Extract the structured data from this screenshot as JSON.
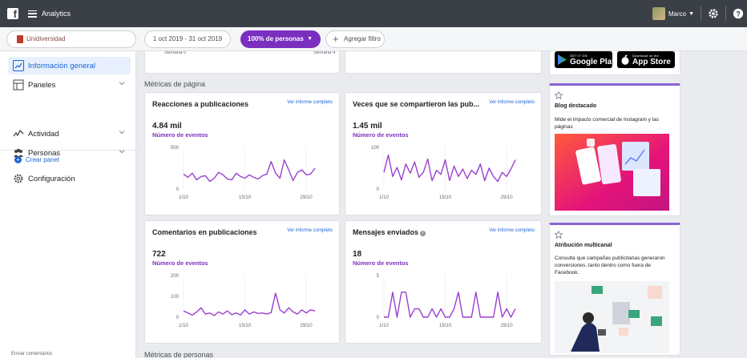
{
  "topbar": {
    "app_title": "Analytics",
    "user_name": "Marco"
  },
  "filters": {
    "source": "Unidiversidad",
    "date_range": "1 oct 2019 - 31 oct 2019",
    "audience": "100% de personas",
    "add_filter": "Agregar filtro"
  },
  "sidebar": {
    "items": [
      {
        "label": "Información general",
        "icon": "overview-chart-icon",
        "active": true
      },
      {
        "label": "Paneles",
        "icon": "dashboards-icon",
        "chevron": true
      },
      {
        "label": "Actividad",
        "icon": "activity-icon",
        "chevron": true
      },
      {
        "label": "Personas",
        "icon": "people-icon",
        "chevron": true
      },
      {
        "label": "Configuración",
        "icon": "settings-gear-icon"
      }
    ],
    "create_panel": "Crear panel",
    "feedback": "Enviar comentarios"
  },
  "main": {
    "top_week_labels": [
      "Semana 0",
      "Semana 4"
    ],
    "section_pages": "Métricas de página",
    "section_people": "Métricas de personas",
    "link_label": "Ver informe completo",
    "metric_label": "Número de eventos",
    "cards": [
      {
        "title": "Reacciones a publicaciones",
        "value": "4.84 mil"
      },
      {
        "title": "Veces que se compartieron las pub...",
        "value": "1.45 mil"
      },
      {
        "title": "Comentarios en publicaciones",
        "value": "722"
      },
      {
        "title": "Mensajes enviados",
        "value": "18",
        "info": true
      }
    ]
  },
  "rail": {
    "google_play_small": "GET IT ON",
    "google_play_large": "Google Play",
    "app_store_small": "Download on the",
    "app_store_large": "App Store",
    "blog": {
      "title": "Blog destacado",
      "desc": "Mide el impacto comercial de Instagram y las páginas"
    },
    "attribution": {
      "title": "Atribución multicanal",
      "desc": "Consulta qué campañas publicitarias generaron conversiones, tanto dentro como fuera de Facebook."
    }
  },
  "colors": {
    "accent_purple": "#7b2fbf",
    "link_blue": "#1a66d6",
    "topbar": "#3b4047"
  },
  "chart_data": [
    {
      "type": "line",
      "title": "Reacciones a publicaciones",
      "x_ticks": [
        "1/10",
        "15/10",
        "29/10"
      ],
      "y_ticks": [
        "500",
        "0"
      ],
      "ylim": [
        0,
        500
      ],
      "x": [
        1,
        2,
        3,
        4,
        5,
        6,
        7,
        8,
        9,
        10,
        11,
        12,
        13,
        14,
        15,
        16,
        17,
        18,
        19,
        20,
        21,
        22,
        23,
        24,
        25,
        26,
        27,
        28,
        29,
        30,
        31
      ],
      "series": [
        {
          "values": [
            180,
            140,
            190,
            110,
            150,
            160,
            90,
            130,
            200,
            170,
            120,
            110,
            190,
            150,
            130,
            170,
            140,
            120,
            160,
            180,
            330,
            190,
            130,
            350,
            230,
            100,
            200,
            230,
            170,
            180,
            250
          ]
        }
      ]
    },
    {
      "type": "line",
      "title": "Veces que se compartieron las pub...",
      "x_ticks": [
        "1/10",
        "15/10",
        "29/10"
      ],
      "y_ticks": [
        "100",
        "0"
      ],
      "ylim": [
        0,
        100
      ],
      "x": [
        1,
        2,
        3,
        4,
        5,
        6,
        7,
        8,
        9,
        10,
        11,
        12,
        13,
        14,
        15,
        16,
        17,
        18,
        19,
        20,
        21,
        22,
        23,
        24,
        25,
        26,
        27,
        28,
        29,
        30,
        31
      ],
      "series": [
        {
          "values": [
            40,
            82,
            30,
            52,
            22,
            60,
            38,
            65,
            28,
            40,
            72,
            20,
            45,
            35,
            70,
            20,
            55,
            30,
            48,
            25,
            45,
            35,
            60,
            20,
            50,
            30,
            18,
            40,
            30,
            48,
            70
          ]
        }
      ]
    },
    {
      "type": "line",
      "title": "Comentarios en publicaciones",
      "x_ticks": [
        "1/10",
        "15/10",
        "29/10"
      ],
      "y_ticks": [
        "200",
        "100",
        "0"
      ],
      "ylim": [
        0,
        200
      ],
      "x": [
        1,
        2,
        3,
        4,
        5,
        6,
        7,
        8,
        9,
        10,
        11,
        12,
        13,
        14,
        15,
        16,
        17,
        18,
        19,
        20,
        21,
        22,
        23,
        24,
        25,
        26,
        27,
        28,
        29,
        30,
        31
      ],
      "series": [
        {
          "values": [
            30,
            20,
            10,
            25,
            45,
            15,
            20,
            8,
            25,
            15,
            30,
            12,
            20,
            10,
            35,
            15,
            25,
            18,
            20,
            15,
            22,
            115,
            35,
            20,
            45,
            25,
            15,
            35,
            20,
            35,
            30
          ]
        }
      ]
    },
    {
      "type": "line",
      "title": "Mensajes enviados",
      "x_ticks": [
        "1/10",
        "15/10",
        "29/10"
      ],
      "y_ticks": [
        "5",
        "0"
      ],
      "ylim": [
        0,
        5
      ],
      "x": [
        1,
        2,
        3,
        4,
        5,
        6,
        7,
        8,
        9,
        10,
        11,
        12,
        13,
        14,
        15,
        16,
        17,
        18,
        19,
        20,
        21,
        22,
        23,
        24,
        25,
        26,
        27,
        28,
        29,
        30,
        31
      ],
      "series": [
        {
          "values": [
            0,
            0,
            3,
            0,
            3,
            3,
            0,
            1,
            1,
            0,
            0,
            1,
            0,
            1,
            0,
            0,
            1,
            3,
            0,
            0,
            0,
            3,
            0,
            0,
            0,
            0,
            3,
            0,
            1,
            0,
            1
          ]
        }
      ]
    }
  ]
}
